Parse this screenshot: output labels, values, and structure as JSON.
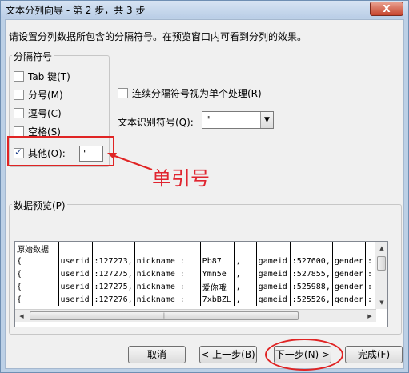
{
  "window": {
    "title": "文本分列向导 - 第 2 步，共 3 步",
    "close_label": "X"
  },
  "instruction": "请设置分列数据所包含的分隔符号。在预览窗口内可看到分列的效果。",
  "delimiters": {
    "group_label": "分隔符号",
    "items": [
      {
        "label": "Tab 键(T)",
        "checked": false
      },
      {
        "label": "分号(M)",
        "checked": false
      },
      {
        "label": "逗号(C)",
        "checked": false
      },
      {
        "label": "空格(S)",
        "checked": false
      },
      {
        "label": "其他(O):",
        "checked": true
      }
    ],
    "other_value": "'"
  },
  "consecutive_label": "连续分隔符号视为单个处理(R)",
  "text_qualifier": {
    "label": "文本识别符号(Q):",
    "value": "\""
  },
  "annotation": "单引号",
  "preview": {
    "group_label": "数据预览(P)",
    "rows": [
      [
        "原始数据",
        "",
        "",
        "",
        "",
        "",
        "",
        "",
        ""
      ],
      [
        "{",
        "userid",
        ":127273,",
        "nickname",
        ":",
        "Pb87",
        ",",
        "gameid",
        ":527600,",
        "gender",
        ":"
      ],
      [
        "{",
        "userid",
        ":127275,",
        "nickname",
        ":",
        "Ymn5e",
        ",",
        "gameid",
        ":527855,",
        "gender",
        ":"
      ],
      [
        "{",
        "userid",
        ":127275,",
        "nickname",
        ":",
        "爱你哦",
        ",",
        "gameid",
        ":525988,",
        "gender",
        ":"
      ],
      [
        "{",
        "userid",
        ":127276,",
        "nickname",
        ":",
        "7xbBZL",
        ",",
        "gameid",
        ":525526,",
        "gender",
        ":"
      ]
    ]
  },
  "buttons": {
    "cancel": "取消",
    "back": "< 上一步(B)",
    "next": "下一步(N) >",
    "finish": "完成(F)"
  },
  "colors": {
    "annotation_red": "#e0242f",
    "window_frame": "#bcd0e6"
  }
}
